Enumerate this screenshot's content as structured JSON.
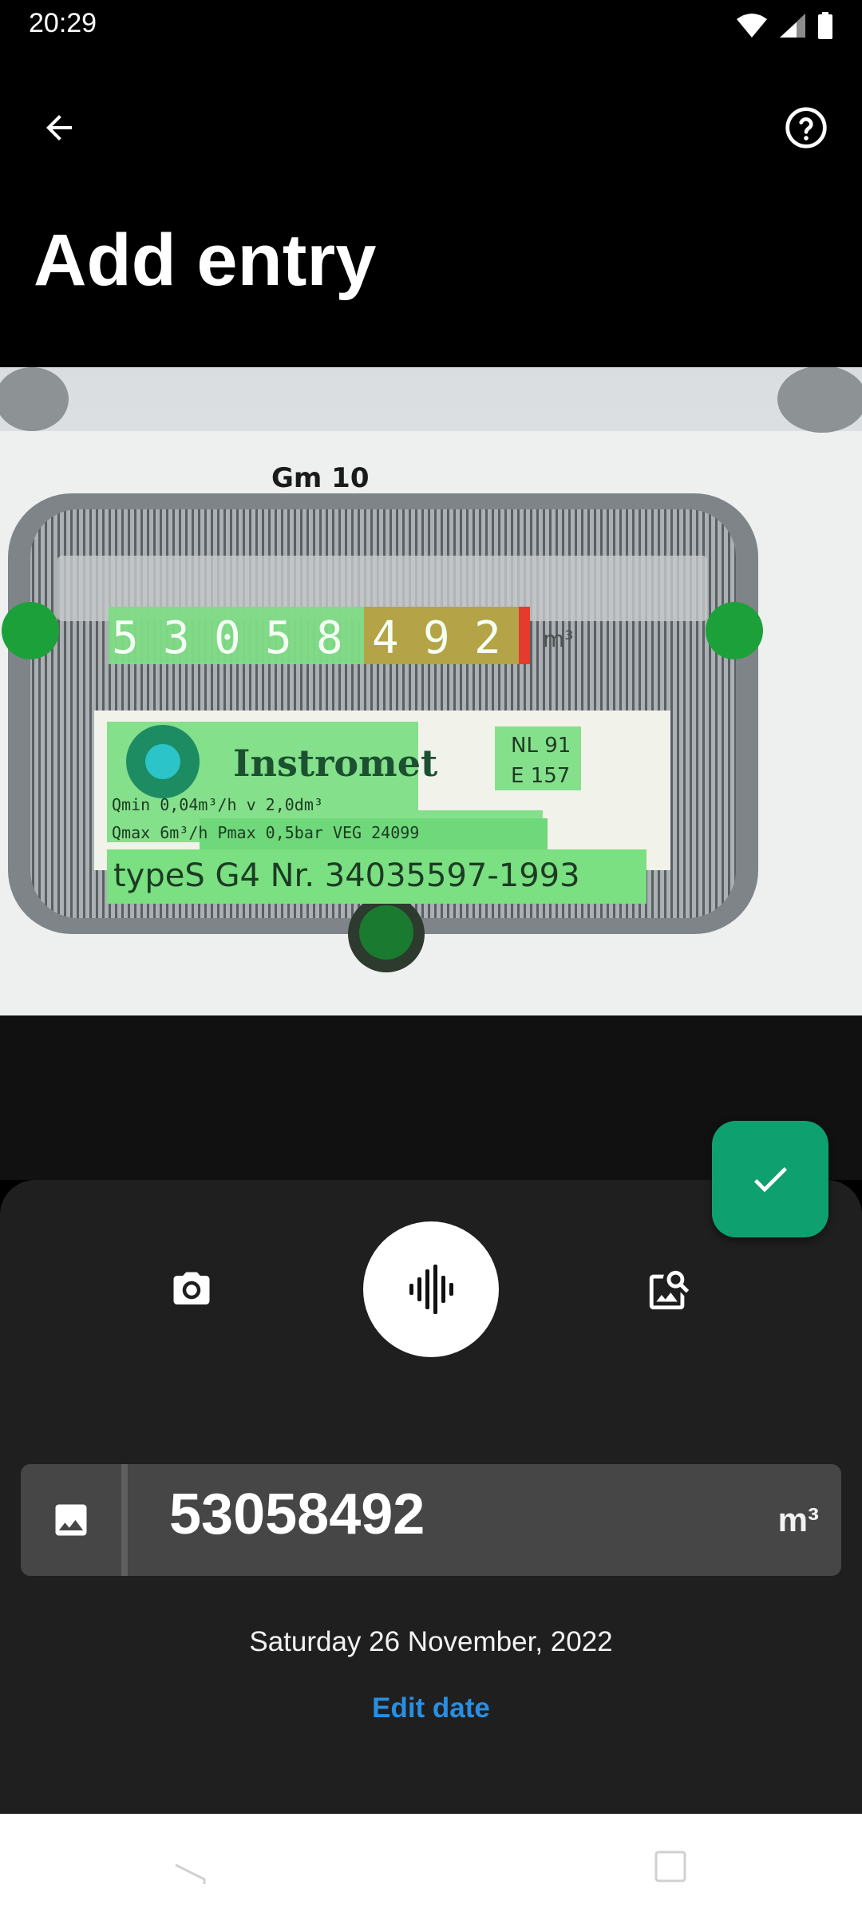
{
  "status_bar": {
    "time": "20:29",
    "icons": [
      "wifi-icon",
      "signal-icon",
      "battery-icon"
    ]
  },
  "app_bar": {
    "title": "Add entry",
    "back_icon": "arrow-left-icon",
    "help_icon": "help-circle-icon"
  },
  "photo": {
    "description_icon": "meter-photo",
    "meter_digits": [
      "5",
      "3",
      "0",
      "5",
      "8",
      "4",
      "9",
      "2"
    ],
    "meter_unit": "m³",
    "handwritten_label": "Gm 10",
    "brand": "Instromet",
    "spec_line_1": "Qmin 0,04m³/h   v   2,0dm³",
    "spec_line_2": "Qmax    6m³/h  Pmax 0,5bar    VEG 24099",
    "type_line": "typeS G4  Nr. 34035597-1993",
    "approval_1": "NL 91",
    "approval_2": "E 157"
  },
  "actions": {
    "confirm_icon": "check-icon",
    "camera_icon": "camera-icon",
    "voice_icon": "voice-wave-icon",
    "gallery_icon": "image-search-icon"
  },
  "reading": {
    "image_icon": "image-icon",
    "value": "53058492",
    "unit": "m³"
  },
  "date": {
    "text": "Saturday 26 November, 2022",
    "edit_label": "Edit date"
  },
  "colors": {
    "accent_green": "#0fa070",
    "link_blue": "#2a8ee0",
    "sheet_bg": "#1f1f1f",
    "field_bg": "#464646"
  }
}
